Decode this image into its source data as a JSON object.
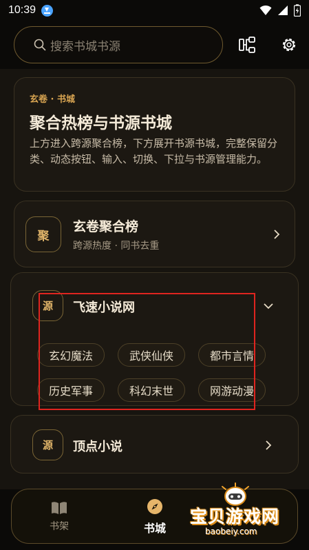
{
  "status": {
    "time": "10:39"
  },
  "search": {
    "placeholder": "搜索书城书源"
  },
  "intro": {
    "tag": "玄卷 · 书城",
    "title": "聚合热榜与书源书城",
    "desc": "上方进入跨源聚合榜，下方展开书源书城，完整保留分类、动态按钮、输入、切换、下拉与书源管理能力。"
  },
  "ranking": {
    "badge": "聚",
    "title": "玄卷聚合榜",
    "subtitle": "跨源热度 · 同书去重"
  },
  "sources": [
    {
      "badge": "源",
      "name": "飞速小说网",
      "expanded": true,
      "categories": [
        "玄幻魔法",
        "武侠仙侠",
        "都市言情",
        "历史军事",
        "科幻末世",
        "网游动漫"
      ]
    },
    {
      "badge": "源",
      "name": "顶点小说",
      "expanded": false
    }
  ],
  "tabs": [
    {
      "label": "书架",
      "icon": "book-open-icon",
      "active": false
    },
    {
      "label": "书城",
      "icon": "compass-icon",
      "active": true
    }
  ],
  "watermark": {
    "text": "宝贝游戏网",
    "url": "baobeiy.com"
  },
  "colors": {
    "accent": "#d9a552",
    "highlight": "#e0241f",
    "background": "#0b0a08"
  }
}
